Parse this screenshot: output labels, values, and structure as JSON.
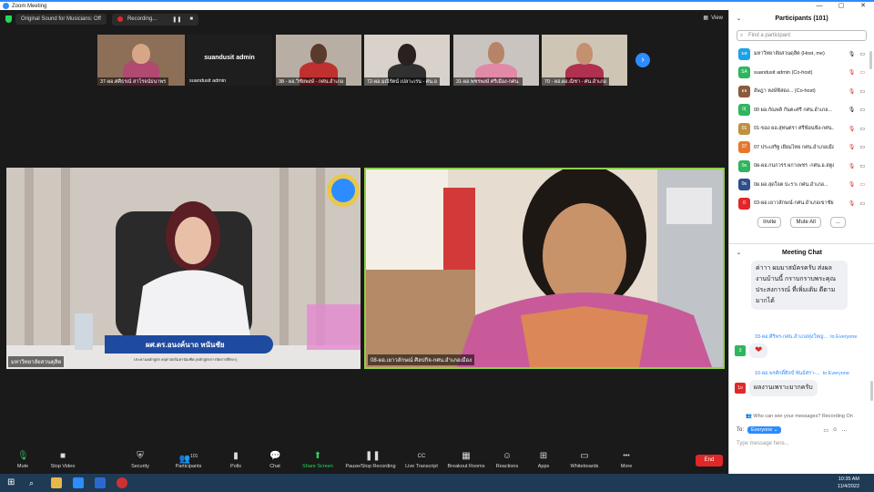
{
  "window": {
    "title": "Zoom Meeting",
    "minimize": "—",
    "maximize": "▢",
    "close": "✕"
  },
  "topbar": {
    "audio_status": "Original Sound for Musicians: Off",
    "recording": "Recording...",
    "pause": "❚❚",
    "stop": "■",
    "view": "View"
  },
  "strip": {
    "tiles": [
      {
        "label": "37-ผอ.ศศิธรณ์ สาโรจน์ธนาพร"
      },
      {
        "label": "suandusit admin",
        "center_name": "suandusit admin"
      },
      {
        "label": "38 - ผอ.วิชัยพงษ์ - กศน.อำเภอ"
      },
      {
        "label": "72-ผอ.มณีรัตน์ เปลาะเรน - ศน.อ"
      },
      {
        "label": "31-ผอ.พชรพงษ์ ศรีเมือง-กศน."
      },
      {
        "label": "70 - ผอ.ผอ.ณิชา - ศน.อำเภอ"
      }
    ]
  },
  "main_videos": [
    {
      "label": "มหาวิทยาลัยสวนดุสิต",
      "nameplate_title": "ผศ.ดร.อนงค์นาถ หนันชัย",
      "nameplate_sub": "ประธานหลักสูตร ครุศาสตร์มหาบัณฑิต (หลักสูตรการจัดการศึกษา)"
    },
    {
      "label": "08-ผอ.เยาวลักษณ์ ศิลปกิจ-กศน.อำเภอเมือง"
    }
  ],
  "toolbar": {
    "items": [
      {
        "label": "Mute",
        "icon": "🎙"
      },
      {
        "label": "Stop Video",
        "icon": "▶"
      },
      {
        "label": "Security",
        "icon": "⛨"
      },
      {
        "label": "Participants",
        "icon": "👥",
        "count": "101"
      },
      {
        "label": "Polls",
        "icon": "▮"
      },
      {
        "label": "Chat",
        "icon": "💬"
      },
      {
        "label": "Share Screen",
        "icon": "⬆"
      },
      {
        "label": "Pause/Stop Recording",
        "icon": "❚❚"
      },
      {
        "label": "Live Transcript",
        "icon": "CC"
      },
      {
        "label": "Breakout Rooms",
        "icon": "▦"
      },
      {
        "label": "Reactions",
        "icon": "☺"
      },
      {
        "label": "Apps",
        "icon": "⊞"
      },
      {
        "label": "Whiteboards",
        "icon": "▭"
      },
      {
        "label": "More",
        "icon": "•••"
      }
    ],
    "end": "End"
  },
  "participants": {
    "header": "Participants (101)",
    "search_placeholder": "Find a participant",
    "rows": [
      {
        "initials": "มส",
        "color": "#1aa3e8",
        "name": "มหาวิทยาลัยสวนดุสิต (Host, me)"
      },
      {
        "initials": "SA",
        "color": "#2fb55d",
        "name": "suandusit admin (Co-host)"
      },
      {
        "initials": "อธ",
        "color": "#8a5a3b",
        "name": "อัษฎา หงษ์ฟัสดง... (Co-host)"
      },
      {
        "initials": "0(",
        "color": "#2fb55d",
        "name": "00 ผอ.กัณพลิ กันตะศรี กศน.อำเภอ..."
      },
      {
        "initials": "01",
        "color": "#c09040",
        "name": "01-ของ ผอ.สุทนต่รา ศรีฟ้อนฟัง-กศน..."
      },
      {
        "initials": "07",
        "color": "#e8772e",
        "name": "07 ประเสริฐ เยี่ยมไทย กศน.อำเภอเมือง..."
      },
      {
        "initials": "0ผ",
        "color": "#2fb55d",
        "name": "0ผ-ผอ.กนกวรร ผกาเพชร -กศน.อ.สตูล"
      },
      {
        "initials": "0ผ",
        "color": "#2d4f8a",
        "name": "0ผ ผอ.สุดใจต ปะราเ กศน.อำเภอ..."
      },
      {
        "initials": "0",
        "color": "#e02828",
        "name": "03-ผอ.เยาวลักษณ์-กศน.อำเภอเขาชัยสน"
      }
    ],
    "invite": "Invite",
    "mute_all": "Mute All",
    "more": "..."
  },
  "chat": {
    "header": "Meeting Chat",
    "msg1": "ค่าาา ผมมาสมัครครับ ส่งผลงานบ้านนี้ กราบกราบพระคุณ ประสงการณ์ ที่เพิ่มเติม ดีตามมากได้",
    "msg2_from": "33-ผอ.ศิริพร-กศน.อำเภอทุ่งใหญ่...",
    "msg2_to": "to Everyone",
    "msg2_body": "❤",
    "msg3_from": "10-ผอ.พรศักดิ์ศิลป์ พันธ์ศรา-...",
    "msg3_to": "to Everyone",
    "msg3_body": "ผลงานเพราะมากครับ",
    "who_can_see": "Who can see your messages? Recording On",
    "to_label": "To:",
    "to_value": "Everyone",
    "type_placeholder": "Type message here..."
  },
  "taskbar": {
    "time": "10:35 AM",
    "date": "11/4/2022"
  },
  "colors": {
    "accent": "#2d8cff",
    "danger": "#e02828",
    "active_speaker": "#8fd04a"
  }
}
